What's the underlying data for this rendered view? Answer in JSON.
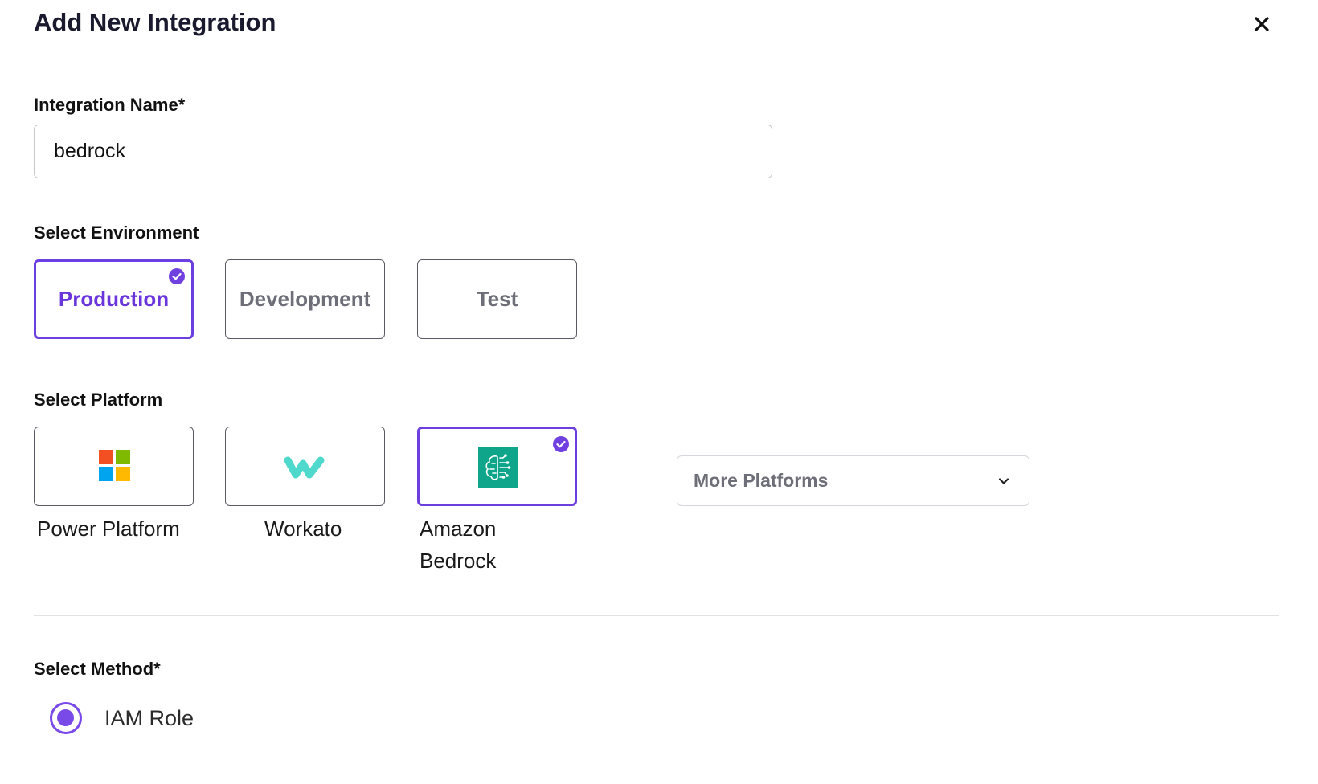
{
  "dialog": {
    "title": "Add New Integration",
    "close_icon": "close-icon"
  },
  "integration_name": {
    "label": "Integration Name*",
    "value": "bedrock"
  },
  "environment": {
    "label": "Select Environment",
    "options": [
      {
        "label": "Production",
        "selected": true
      },
      {
        "label": "Development",
        "selected": false
      },
      {
        "label": "Test",
        "selected": false
      }
    ]
  },
  "platform": {
    "label": "Select Platform",
    "options": [
      {
        "label": "Power Platform",
        "icon": "microsoft-logo-icon",
        "selected": false
      },
      {
        "label": "Workato",
        "icon": "workato-logo-icon",
        "selected": false
      },
      {
        "label": "Amazon Bedrock",
        "icon": "amazon-bedrock-logo-icon",
        "selected": true
      }
    ],
    "more_label": "More Platforms"
  },
  "method": {
    "label": "Select Method*",
    "options": [
      {
        "label": "IAM Role",
        "selected": true
      }
    ]
  },
  "colors": {
    "accent": "#6e3fe0",
    "bedrock_teal": "#0ea58a",
    "workato_teal": "#4fd8cc"
  }
}
